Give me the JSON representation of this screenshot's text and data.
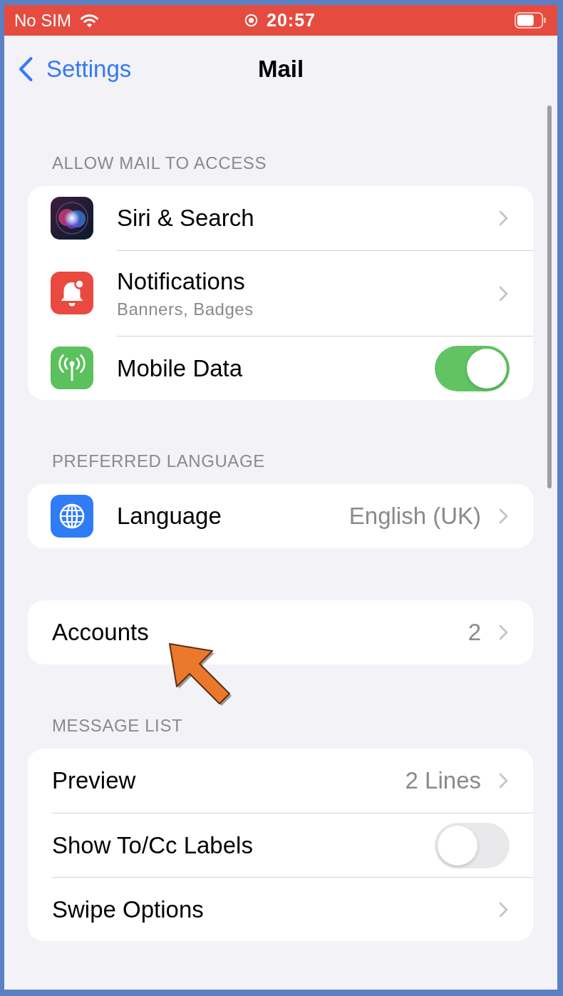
{
  "status_bar": {
    "carrier": "No SIM",
    "time": "20:57"
  },
  "nav_bar": {
    "back_label": "Settings",
    "title": "Mail"
  },
  "sections": [
    {
      "header": "ALLOW MAIL TO ACCESS",
      "rows": [
        {
          "kind": "link",
          "label": "Siri & Search"
        },
        {
          "kind": "link",
          "label": "Notifications",
          "subtitle": "Banners, Badges"
        },
        {
          "kind": "toggle",
          "label": "Mobile Data",
          "on": true
        }
      ]
    },
    {
      "header": "PREFERRED LANGUAGE",
      "rows": [
        {
          "kind": "link",
          "label": "Language",
          "value": "English (UK)"
        }
      ]
    },
    {
      "rows": [
        {
          "kind": "link",
          "label": "Accounts",
          "value": "2"
        }
      ]
    },
    {
      "header": "MESSAGE LIST",
      "rows": [
        {
          "kind": "link",
          "label": "Preview",
          "value": "2 Lines"
        },
        {
          "kind": "toggle",
          "label": "Show To/Cc Labels",
          "on": false
        },
        {
          "kind": "link",
          "label": "Swipe Options"
        }
      ]
    }
  ]
}
